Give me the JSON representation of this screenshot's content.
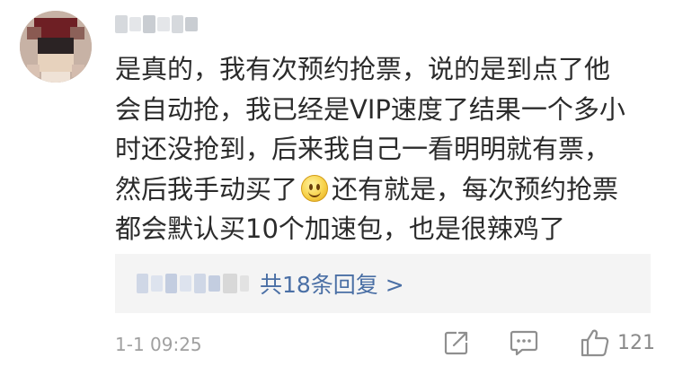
{
  "comment": {
    "author_avatar": "pixelated-avatar",
    "author_name": "",
    "lines": [
      "是真的，我有次预约抢票，说的是到点了他",
      "会自动抢，我已经是VIP速度了结果一个多小",
      "时还没抢到，后来我自己一看明明就有票，",
      "然后我手动买了",
      "还有就是，每次预约抢票",
      "都会默认买10个加速包，也是很辣鸡了"
    ],
    "emoji": "smile-emoji"
  },
  "replies": {
    "link_text": "共18条回复 >"
  },
  "footer": {
    "timestamp": "1-1 09:25",
    "like_count": "121"
  },
  "icons": {
    "share": "share-icon",
    "comment": "comment-icon",
    "like": "thumbs-up-icon"
  },
  "colors": {
    "text": "#2b2b2b",
    "link": "#4a6fa5",
    "muted": "#a0a0a0",
    "panel_bg": "#f4f4f4"
  }
}
